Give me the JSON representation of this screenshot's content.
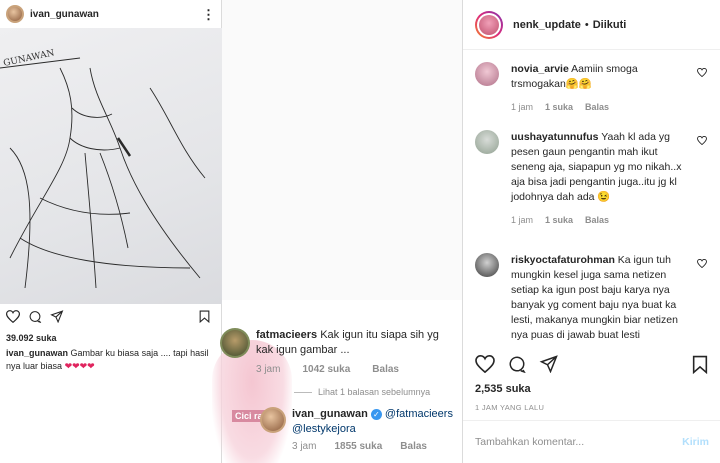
{
  "left_post": {
    "username": "ivan_gunawan",
    "sketch_text": "GUNAWAN",
    "likes": "39.092 suka",
    "caption_user": "ivan_gunawan",
    "caption_text": "Gambar ku  biasa saja .... tapi hasil nya luar biasa",
    "caption_emoji": "❤❤❤❤"
  },
  "thread": {
    "comment1": {
      "user": "fatmacieers",
      "text": "Kak igun itu siapa sih yg kak igun gambar ...",
      "time": "3 jam",
      "likes": "1042 suka",
      "reply": "Balas"
    },
    "view_previous": "Lihat 1 balasan sebelumnya",
    "comment2": {
      "user": "ivan_gunawan",
      "mention1": "@fatmacieers",
      "mention2": "@lestykejora",
      "time": "3 jam",
      "likes": "1855 suka",
      "reply": "Balas"
    },
    "bg_label": "Cici rara"
  },
  "right_post": {
    "username": "nenk_update",
    "dot": "•",
    "follow_status": "Diikuti",
    "comments": [
      {
        "user": "novia_arvie",
        "text": "Aamiin smoga trsmogakan🤗🤗",
        "time": "1 jam",
        "likes": "1 suka",
        "reply": "Balas"
      },
      {
        "user": "uushayatunnufus",
        "text": "Yaah kl ada yg pesen gaun pengantin mah ikut seneng aja, siapapun yg mo nikah..x aja bisa jadi pengantin juga..itu jg kl jodohnya dah ada 😉",
        "time": "1 jam",
        "likes": "1 suka",
        "reply": "Balas"
      },
      {
        "user": "riskyoctafaturohman",
        "text": "Ka igun tuh mungkin kesel juga sama netizen setiap ka igun post baju karya nya banyak yg coment baju nya buat ka lesti, makanya mungkin biar netizen nya puas di jawab buat lesti",
        "time": "",
        "likes": "",
        "reply": ""
      }
    ],
    "likes": "2,535 suka",
    "timestamp": "1 JAM YANG LALU",
    "comment_placeholder": "Tambahkan komentar...",
    "send_label": "Kirim"
  },
  "colors": {
    "accent": "#3897f0",
    "heart": "#e0245e",
    "muted": "#8e8e8e"
  }
}
